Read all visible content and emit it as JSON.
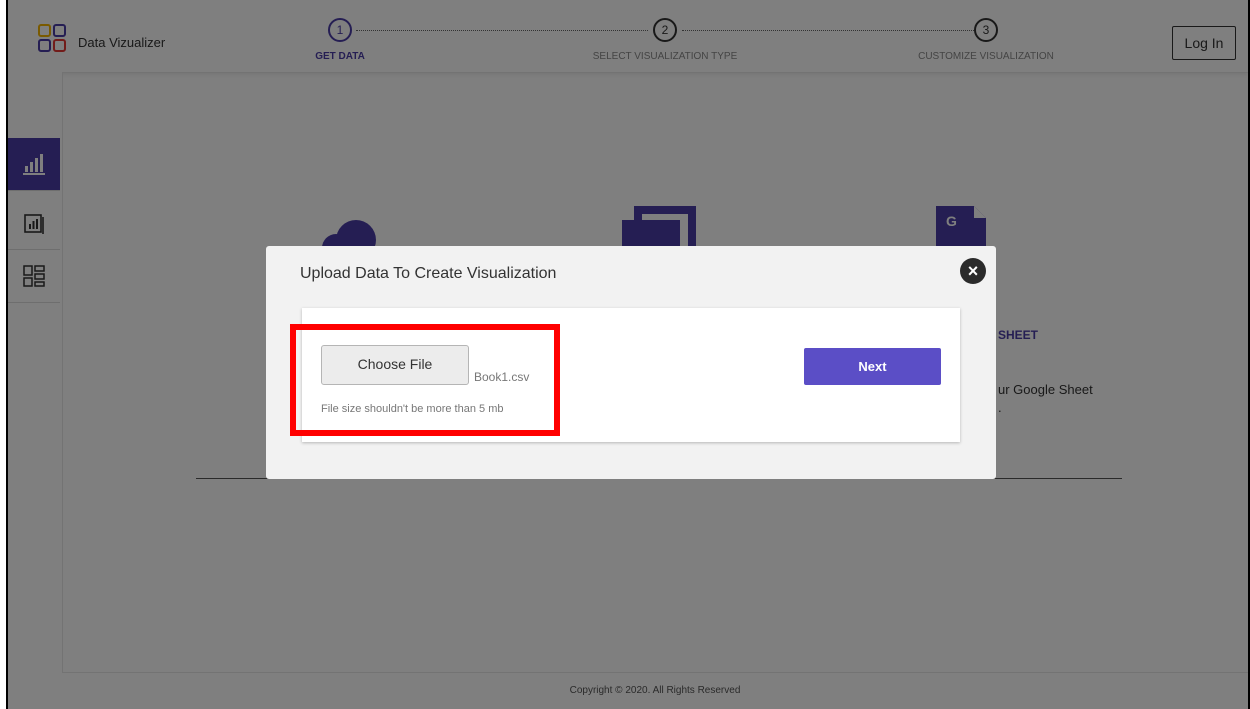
{
  "header": {
    "brand": "Data Vizualizer",
    "steps": [
      {
        "num": "1",
        "label": "GET DATA"
      },
      {
        "num": "2",
        "label": "SELECT VISUALIZATION TYPE"
      },
      {
        "num": "3",
        "label": "CUSTOMIZE VISUALIZATION"
      }
    ],
    "login_label": "Log In"
  },
  "sidebar": {
    "items": [
      {
        "icon": "bar-chart-icon",
        "active": true
      },
      {
        "icon": "report-chart-icon",
        "active": false
      },
      {
        "icon": "dashboard-grid-icon",
        "active": false
      }
    ]
  },
  "main": {
    "card_partial_title": "SHEET",
    "card_partial_desc_1": "ur Google Sheet",
    "card_partial_desc_2": "."
  },
  "footer": {
    "text": "Copyright © 2020. All Rights Reserved"
  },
  "modal": {
    "title": "Upload Data To Create Visualization",
    "close_symbol": "×",
    "choose_label": "Choose File",
    "filename": "Book1.csv",
    "hint": "File size shouldn't be more than 5 mb",
    "next_label": "Next"
  },
  "colors": {
    "accent": "#4b3ca7",
    "next_button": "#5b4ec6",
    "highlight": "#ff0000"
  }
}
